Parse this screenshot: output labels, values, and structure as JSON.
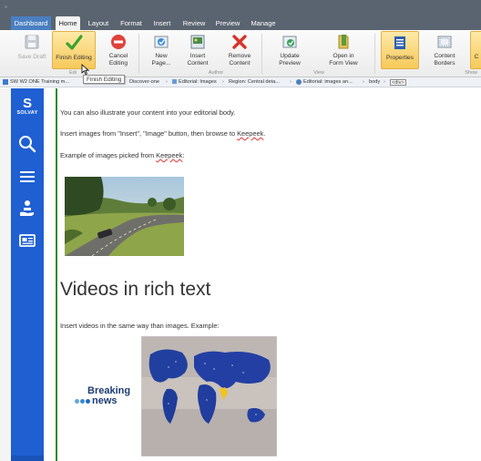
{
  "ribbon_tabs": [
    "Dashboard",
    "Home",
    "Layout",
    "Format",
    "Insert",
    "Review",
    "Preview",
    "Manage"
  ],
  "ribbon": {
    "save_draft": "Save Draft",
    "finish_editing": "Finish Editing",
    "cancel_editing": "Cancel Editing",
    "new_page": "New Page...",
    "insert_content": "Insert Content",
    "remove_content": "Remove Content",
    "update_preview": "Update Preview",
    "open_in_form_view": "Open in Form View",
    "properties": "Properties",
    "content_borders": "Content Borders",
    "partial_button": "C",
    "groups": {
      "edit": "Edi",
      "author": "Author",
      "view": "View",
      "show": "Show"
    }
  },
  "tooltip": "Finish Editing",
  "breadcrumb": [
    "SW W2 ONE Training m...",
    "Discover-one",
    "Editorial: Images",
    "Region: Central deta...",
    "Editorial: images an...",
    "body",
    "<div>"
  ],
  "nav": {
    "logo_text": "SOLVAY",
    "logo_letter": "S"
  },
  "content": {
    "p1": "You can also illustrate your content into your editorial body.",
    "p2_before": "Insert images from \"Insert\", \"Image\" button, then browse to ",
    "p2_link": "Keepeek",
    "p2_after": ".",
    "p3_before": "Example of images picked from ",
    "p3_link": "Keepeek",
    "p3_after": ":",
    "heading": "Videos in rich text",
    "p4": "Insert videos in the same way than images. Example:",
    "breaking": "Breaking",
    "news": "news"
  },
  "colors": {
    "nav_blue": "#1f5fd2",
    "highlight": "#f7c95a",
    "green_line": "#2d8a2d",
    "tab_bar": "#5a6470"
  }
}
